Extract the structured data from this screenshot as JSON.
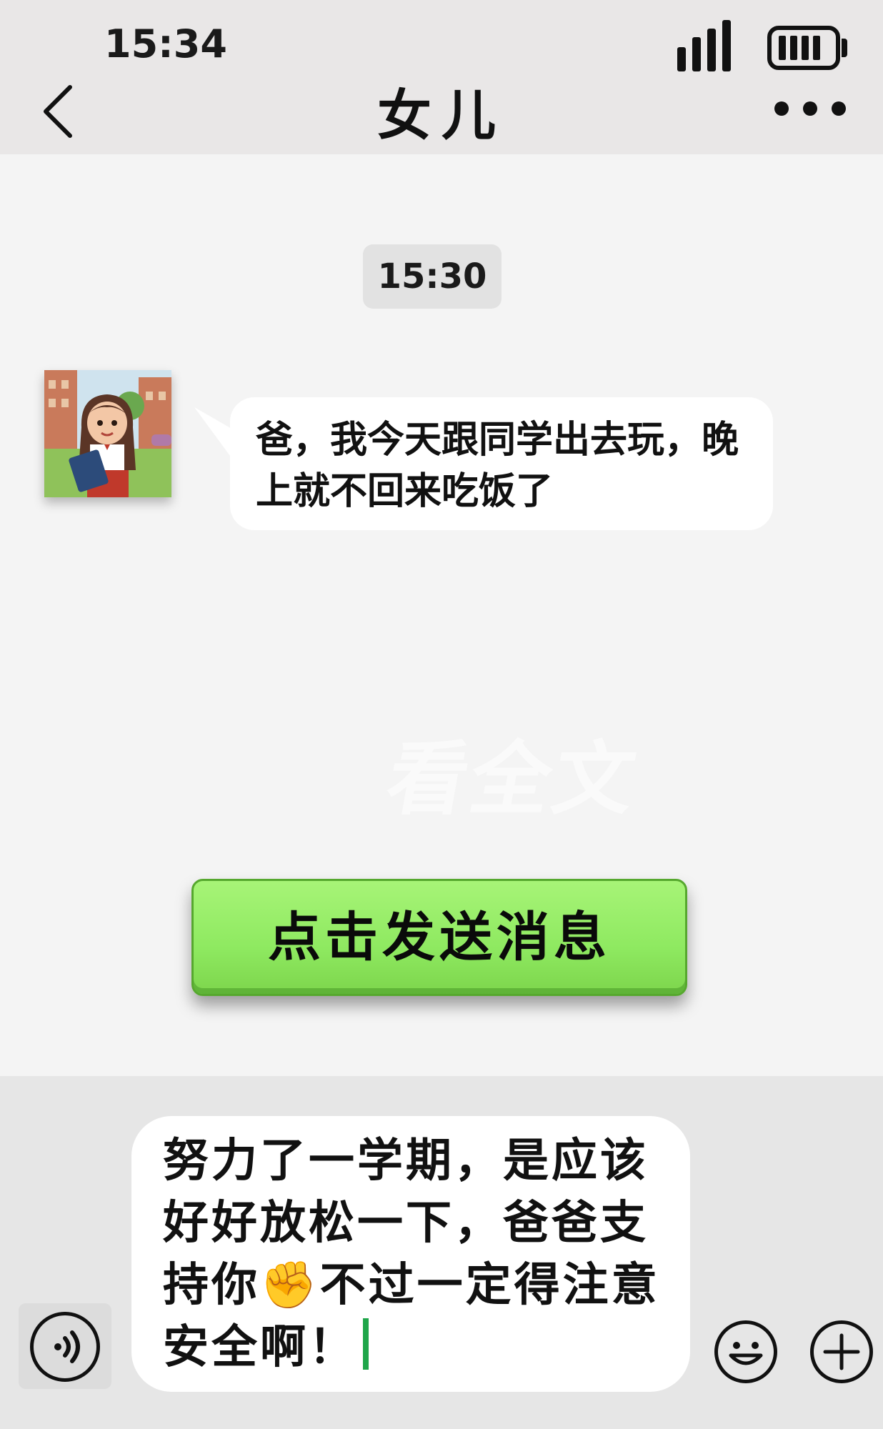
{
  "status_bar": {
    "time": "15:34",
    "signal_icon": "signal-bars-icon",
    "battery_icon": "battery-icon"
  },
  "header": {
    "back_icon": "chevron-left-icon",
    "title": "女儿",
    "more_icon": "more-dots-icon"
  },
  "conversation": {
    "timestamp": "15:30",
    "messages": [
      {
        "sender": "女儿",
        "avatar_icon": "avatar-girl-cartoon",
        "text": "爸，我今天跟同学出去玩，晚上就不回来吃饭了"
      }
    ],
    "watermark": "看全文"
  },
  "send_button": {
    "label": "点击发送消息",
    "color": "#8ee960"
  },
  "composer": {
    "voice_icon": "voice-icon",
    "draft_text": "努力了一学期，是应该好好放松一下，爸爸支持你✊不过一定得注意安全啊！",
    "emoji_icon": "emoji-smile-icon",
    "plus_icon": "plus-icon"
  }
}
